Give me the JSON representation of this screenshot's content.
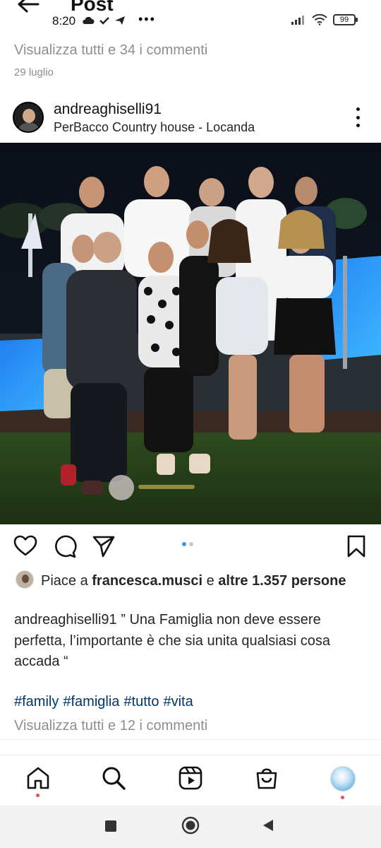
{
  "header": {
    "title": "Post",
    "back_icon": "back-arrow-icon"
  },
  "status_bar": {
    "time": "8:20",
    "more": "•••",
    "battery": "99"
  },
  "previous_post": {
    "view_comments": "Visualizza tutti e 34 i commenti",
    "date": "29 luglio"
  },
  "post": {
    "username": "andreaghiselli91",
    "location": "PerBacco Country house - Locanda",
    "likes_prefix": "Piace a ",
    "likes_user": "francesca.musci",
    "likes_middle": " e ",
    "likes_count": "altre 1.357 persone",
    "caption_user": "andreaghiselli91",
    "caption_text": " ” Una Famiglia non deve essere perfetta, l’importante è che sia unita qualsiasi cosa accada “",
    "hashtags": [
      "#family",
      "#famiglia",
      "#tutto",
      "#vita"
    ],
    "view_comments": "Visualizza tutti e 12 i commenti"
  },
  "colors": {
    "accent_blue": "#3897f0",
    "hashtag_link": "#00376b",
    "muted_text": "#8e8e8e",
    "notification_dot": "#ed4956"
  }
}
